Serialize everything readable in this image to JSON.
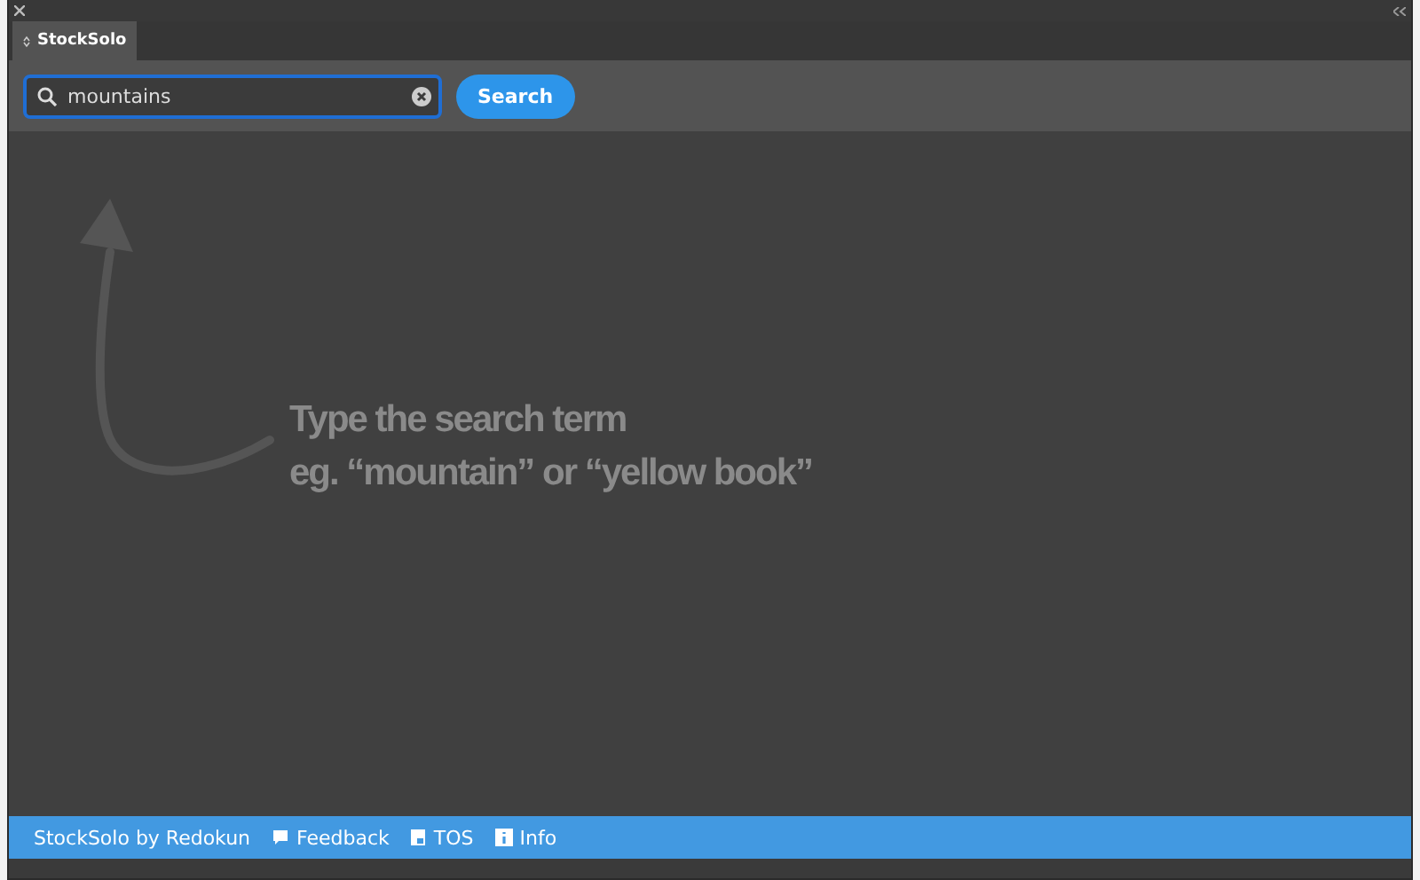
{
  "panel_tab": {
    "label": "StockSolo"
  },
  "search": {
    "value": "mountains",
    "focused": true,
    "button": "Search"
  },
  "hint": {
    "lines": [
      "Type the search term",
      "eg. “mountain” or “yellow book”"
    ]
  },
  "footer": [
    {
      "kind": "brand",
      "label": "StockSolo by Redokun"
    },
    {
      "kind": "feedback",
      "label": "Feedback"
    },
    {
      "kind": "tos",
      "label": "TOS"
    },
    {
      "kind": "info",
      "label": "Info"
    }
  ]
}
